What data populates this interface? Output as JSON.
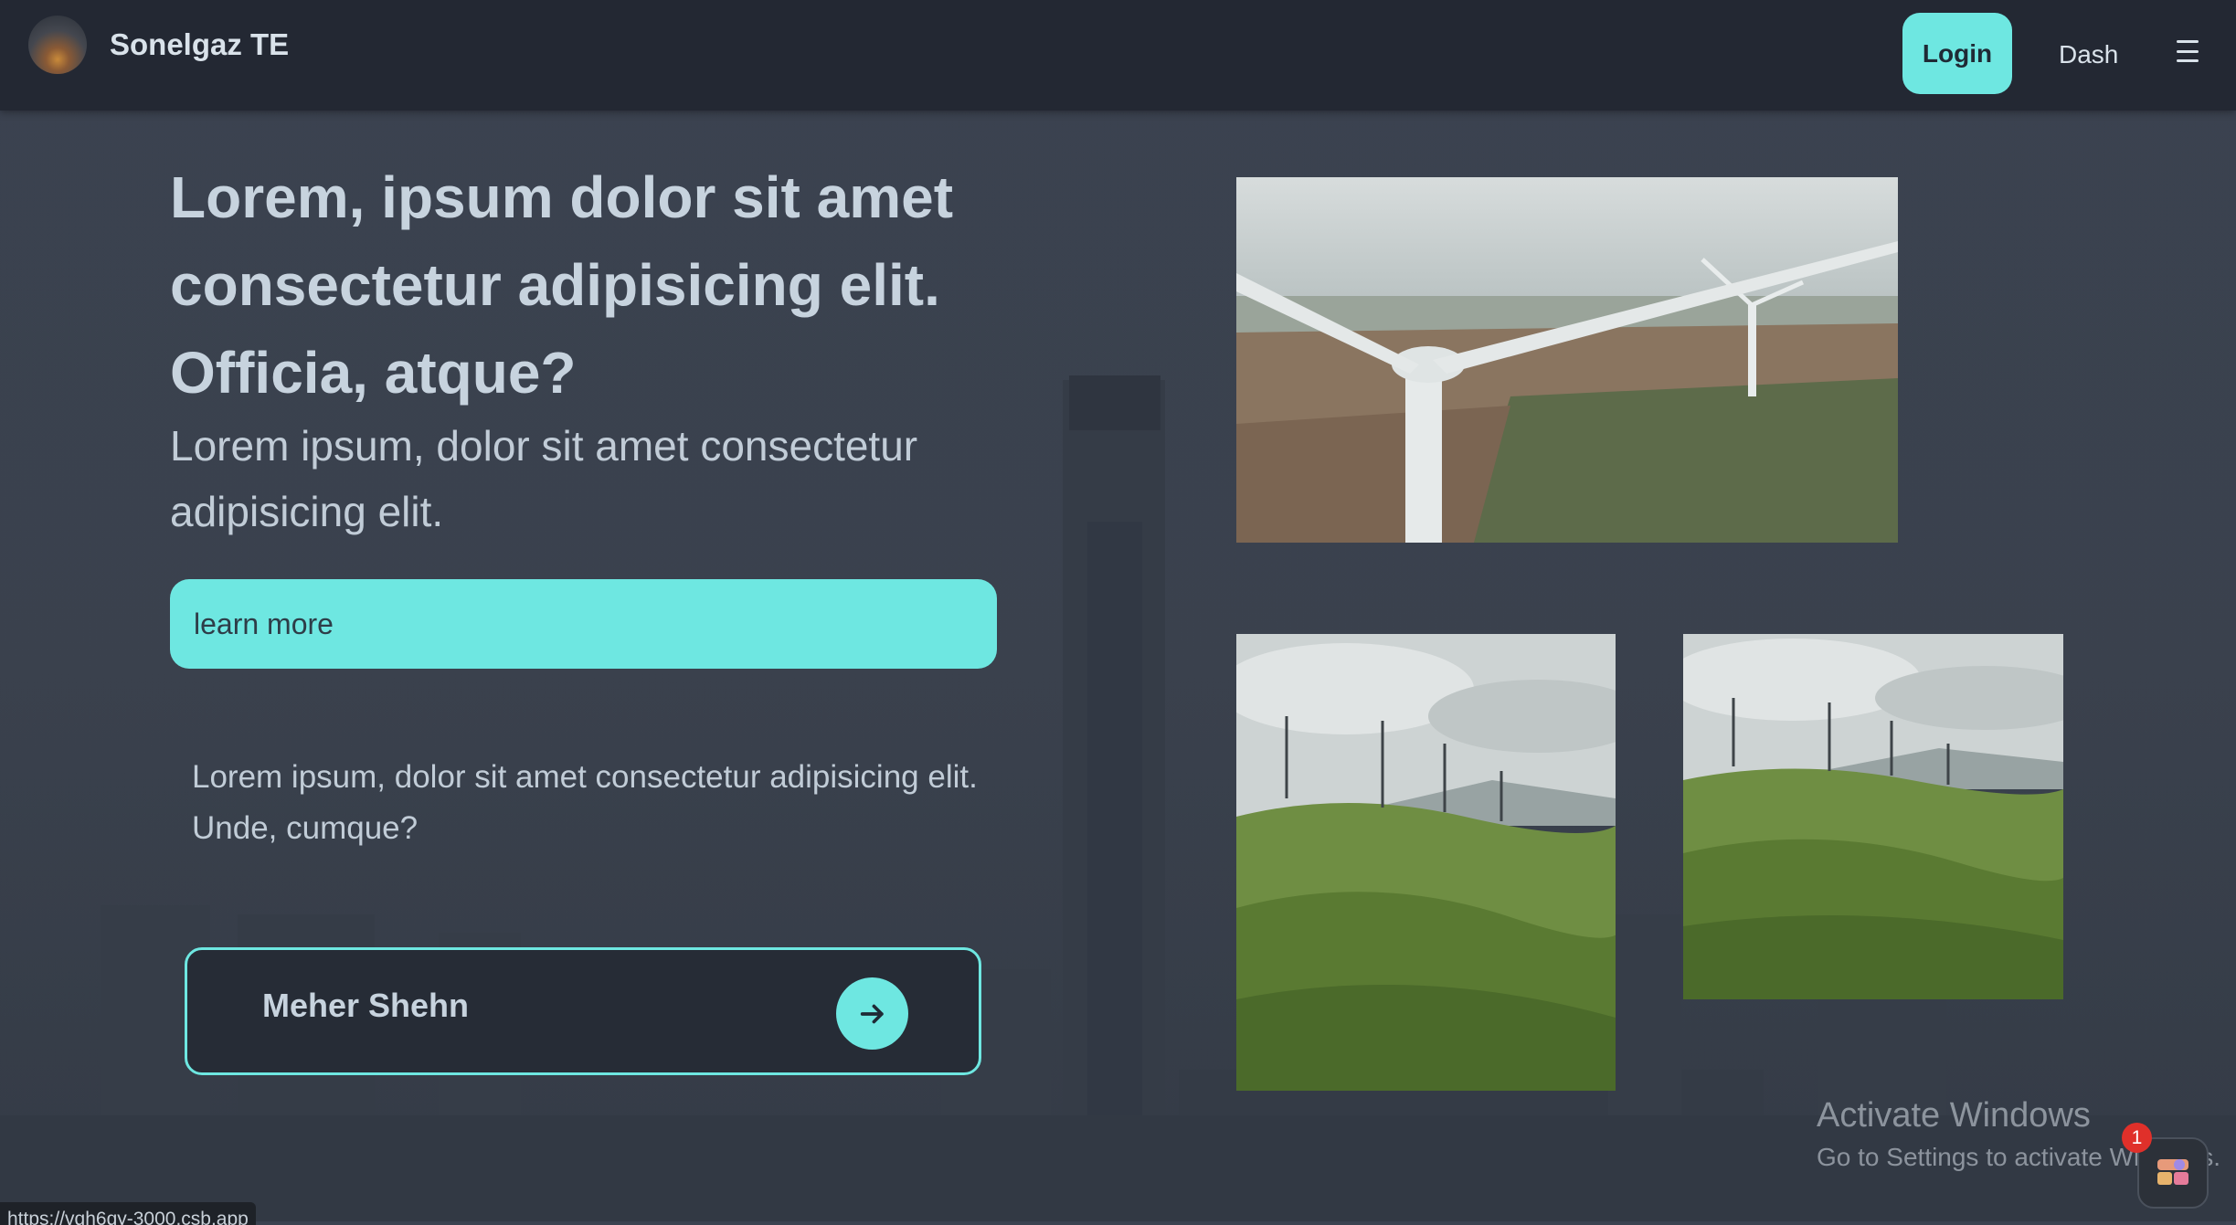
{
  "navbar": {
    "brand": "Sonelgaz TE",
    "login_label": "Login",
    "dash_label": "Dash",
    "menu_icon": "hamburger-menu-icon"
  },
  "hero": {
    "title": "Lorem, ipsum dolor sit amet consectetur adipisicing elit. Officia, atque?",
    "subtitle": "Lorem ipsum, dolor sit amet consectetur adipisicing elit.",
    "cta_label": "learn more",
    "paragraph": "Lorem ipsum, dolor sit amet consectetur adipisicing elit. Unde, cumque?"
  },
  "profile": {
    "name": "Meher Shehn",
    "arrow_icon": "arrow-right-icon"
  },
  "gallery": {
    "images": [
      "wind-turbine-aerial-image",
      "wind-turbines-green-hills-image",
      "wind-turbines-green-hills-image"
    ]
  },
  "watermark": {
    "title": "Activate Windows",
    "subtitle": "Go to Settings to activate Windows."
  },
  "statusbar": {
    "url": "https://vqh6qy-3000.csb.app"
  },
  "assistant": {
    "badge_count": "1"
  },
  "colors": {
    "accent": "#6ee7e1",
    "navbar": "#232833",
    "background": "#3a414d"
  }
}
